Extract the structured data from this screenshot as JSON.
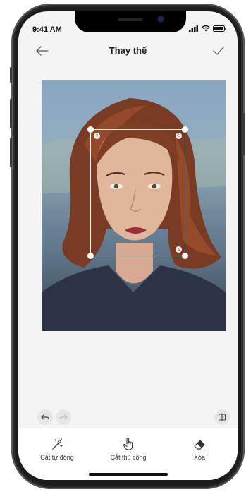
{
  "status_bar": {
    "time": "9:41 AM"
  },
  "header": {
    "title": "Thay thế"
  },
  "toolbar": {
    "undo_icon": "undo-icon",
    "redo_icon": "redo-icon",
    "compare_icon": "compare-icon"
  },
  "tools": [
    {
      "label": "Cắt tự động",
      "icon": "magic-wand-icon"
    },
    {
      "label": "Cắt thủ công",
      "icon": "hand-pointer-icon"
    },
    {
      "label": "Xóa",
      "icon": "eraser-icon"
    }
  ],
  "colors": {
    "screen_bg": "#f4f4f4",
    "title": "#222222",
    "accent": "#1a2a55"
  }
}
